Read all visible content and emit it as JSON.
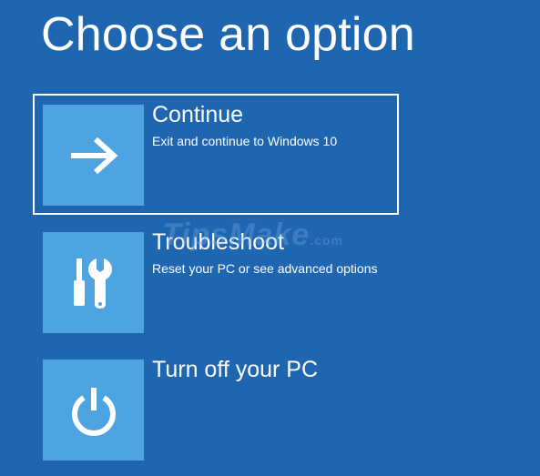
{
  "page": {
    "title": "Choose an option"
  },
  "options": [
    {
      "label": "Continue",
      "description": "Exit and continue to Windows 10",
      "icon": "arrow-right-icon",
      "selected": true
    },
    {
      "label": "Troubleshoot",
      "description": "Reset your PC or see advanced options",
      "icon": "tools-icon",
      "selected": false
    },
    {
      "label": "Turn off your PC",
      "description": "",
      "icon": "power-icon",
      "selected": false
    }
  ],
  "watermark": {
    "text": "TipsMake",
    "suffix": ".com"
  },
  "colors": {
    "background": "#1f66b1",
    "tile": "#4da4e0",
    "text": "#ffffff",
    "selection_border": "#ffffff"
  }
}
